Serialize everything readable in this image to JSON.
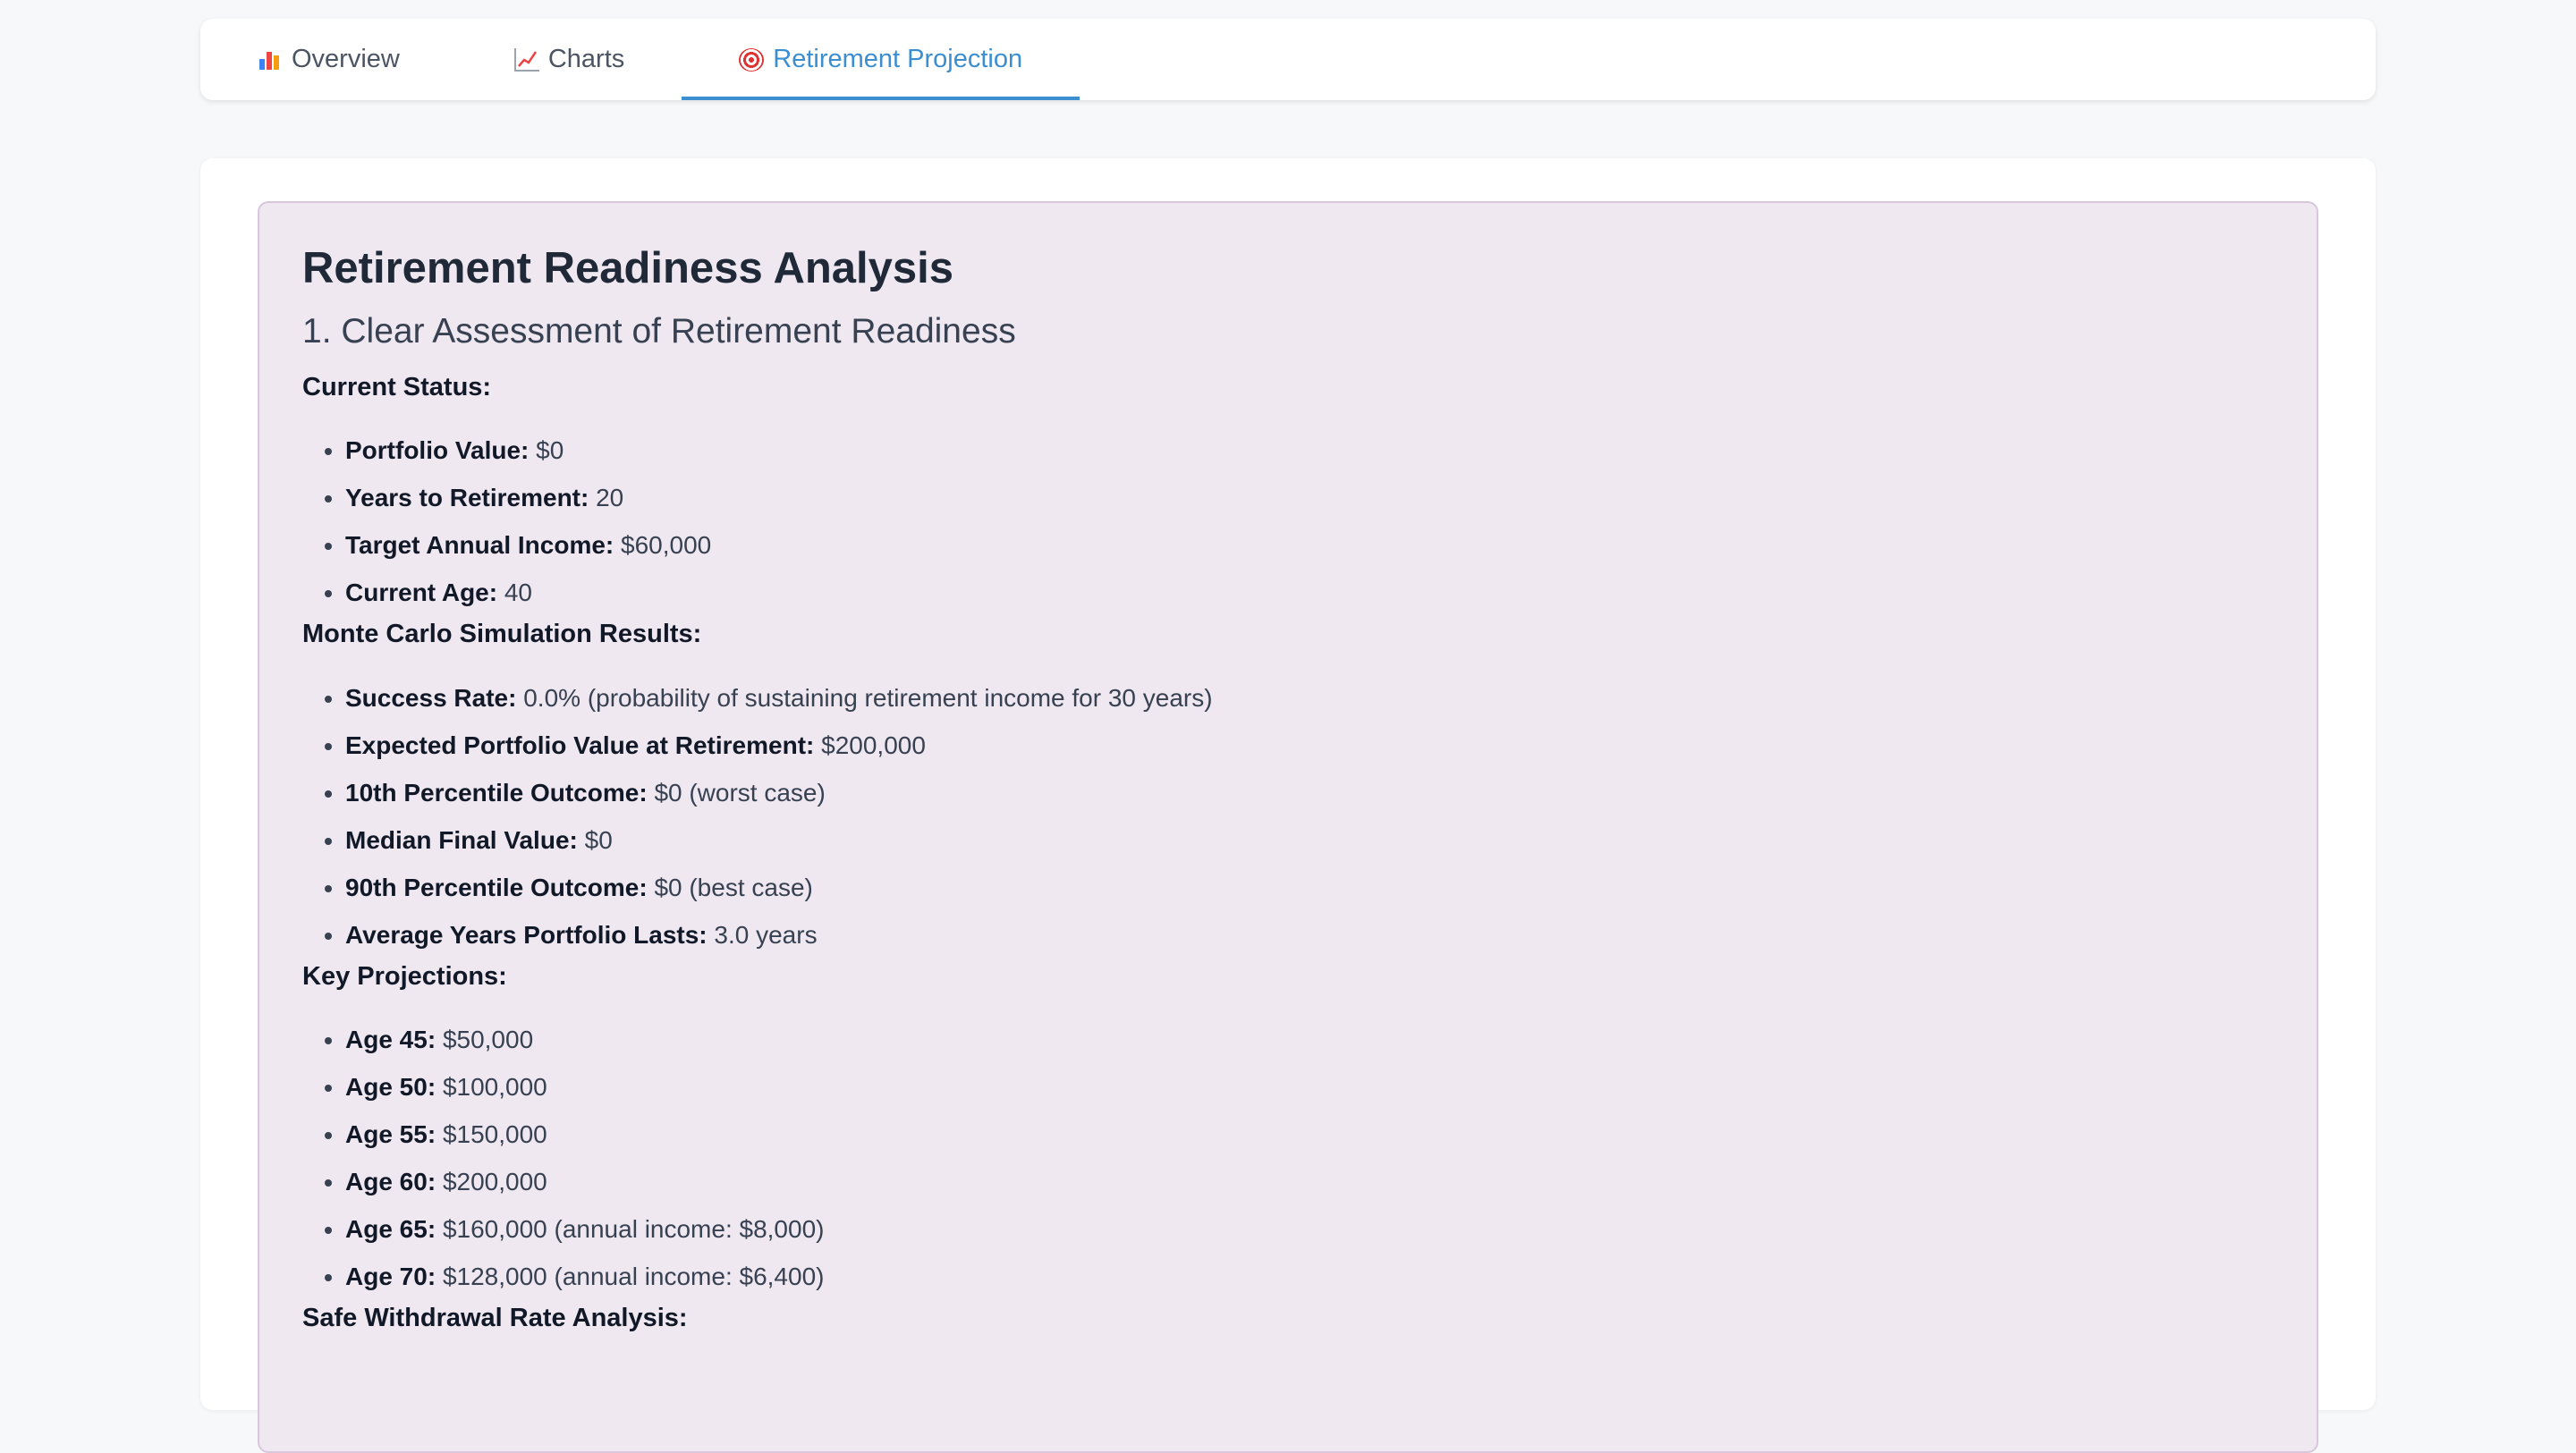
{
  "tabs": [
    {
      "label": "Overview",
      "icon": "bar-chart-icon"
    },
    {
      "label": "Charts",
      "icon": "line-chart-icon"
    },
    {
      "label": "Retirement Projection",
      "icon": "target-icon"
    }
  ],
  "active_tab": "Retirement Projection",
  "colors": {
    "accent": "#3b8fd1",
    "panel_bg": "#efe8f0"
  },
  "analysis": {
    "title": "Retirement Readiness Analysis",
    "subtitle": "1. Clear Assessment of Retirement Readiness",
    "current_status": {
      "heading": "Current Status:",
      "items": [
        {
          "label": "Portfolio Value:",
          "value": "$0"
        },
        {
          "label": "Years to Retirement:",
          "value": "20"
        },
        {
          "label": "Target Annual Income:",
          "value": "$60,000"
        },
        {
          "label": "Current Age:",
          "value": "40"
        }
      ]
    },
    "monte_carlo": {
      "heading": "Monte Carlo Simulation Results:",
      "items": [
        {
          "label": "Success Rate:",
          "value": "0.0% (probability of sustaining retirement income for 30 years)"
        },
        {
          "label": "Expected Portfolio Value at Retirement:",
          "value": "$200,000"
        },
        {
          "label": "10th Percentile Outcome:",
          "value": "$0 (worst case)"
        },
        {
          "label": "Median Final Value:",
          "value": "$0"
        },
        {
          "label": "90th Percentile Outcome:",
          "value": "$0 (best case)"
        },
        {
          "label": "Average Years Portfolio Lasts:",
          "value": "3.0 years"
        }
      ]
    },
    "key_projections": {
      "heading": "Key Projections:",
      "items": [
        {
          "label": "Age 45:",
          "value": "$50,000"
        },
        {
          "label": "Age 50:",
          "value": "$100,000"
        },
        {
          "label": "Age 55:",
          "value": "$150,000"
        },
        {
          "label": "Age 60:",
          "value": "$200,000"
        },
        {
          "label": "Age 65:",
          "value": "$160,000 (annual income: $8,000)"
        },
        {
          "label": "Age 70:",
          "value": "$128,000 (annual income: $6,400)"
        }
      ]
    },
    "safe_withdrawal": {
      "heading": "Safe Withdrawal Rate Analysis:"
    }
  }
}
